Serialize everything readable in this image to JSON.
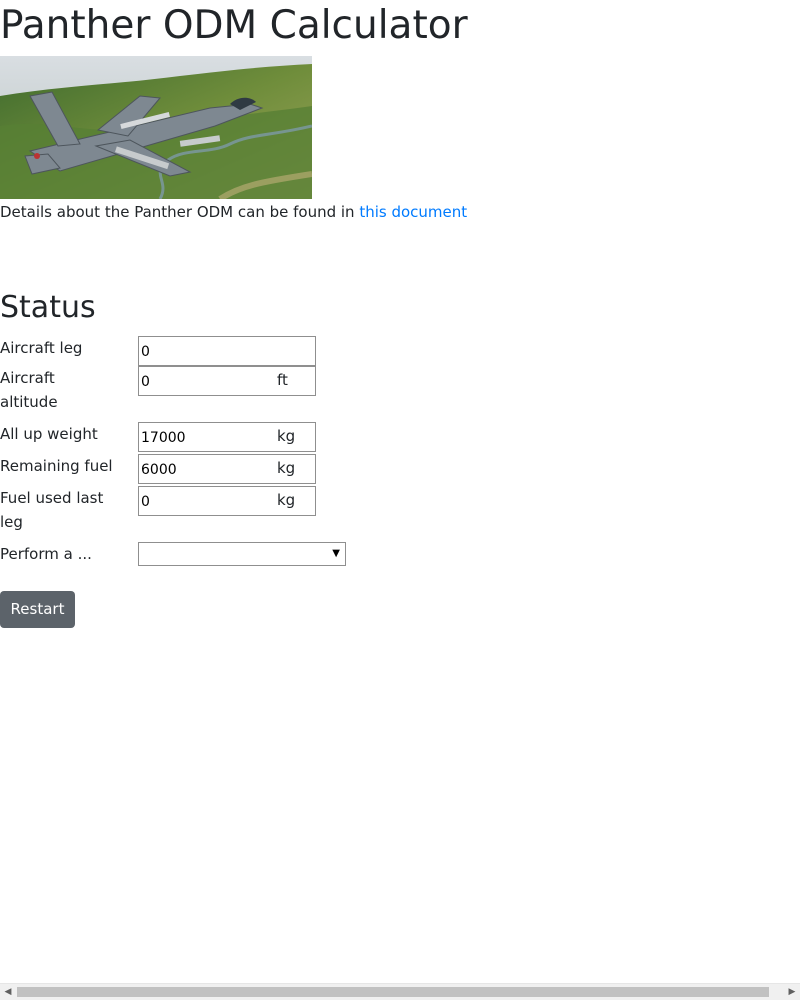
{
  "page": {
    "title": "Panther ODM Calculator",
    "intro_text": "Details about the Panther ODM can be found in ",
    "intro_link": "this document"
  },
  "status": {
    "heading": "Status",
    "fields": [
      {
        "label": "Aircraft leg",
        "value": "0",
        "unit": ""
      },
      {
        "label": "Aircraft altitude",
        "value": "0",
        "unit": "ft"
      },
      {
        "label": "All up weight",
        "value": "17000",
        "unit": "kg"
      },
      {
        "label": "Remaining fuel",
        "value": "6000",
        "unit": "kg"
      },
      {
        "label": "Fuel used last leg",
        "value": "0",
        "unit": "kg"
      }
    ],
    "perform_label": "Perform a ...",
    "perform_value": ""
  },
  "actions": {
    "restart_label": "Restart"
  },
  "icons": {
    "image": "jet-aircraft-photo",
    "dropdown": "caret-down-icon",
    "scroll_left": "scroll-left-icon",
    "scroll_right": "scroll-right-icon"
  },
  "colors": {
    "link": "#007bff",
    "button": "#5c636a",
    "text": "#212529"
  }
}
